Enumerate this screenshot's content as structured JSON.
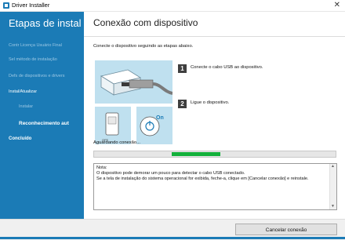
{
  "window": {
    "title": "Driver Installer",
    "close_icon": "close-icon"
  },
  "sidebar": {
    "title": "Etapas de instal",
    "steps": [
      {
        "label": "Contr Licença Usuário Final",
        "state": "done"
      },
      {
        "label": "Sel método de instalação",
        "state": "done"
      },
      {
        "label": "Defs de dispositivos e drivers",
        "state": "done"
      },
      {
        "label": "Instal/Atualizar",
        "state": "current"
      },
      {
        "label": "Instalar",
        "state": "sub-done"
      },
      {
        "label": "Reconhecimento aut",
        "state": "sub-current"
      },
      {
        "label": "Concluído",
        "state": "pending"
      }
    ]
  },
  "main": {
    "title": "Conexão com dispositivo",
    "instruction": "Conecte o dispositivo seguindo as etapas abaixo.",
    "steps": [
      {
        "number": "1",
        "text": "Conecte o cabo USB ao dispositivo."
      },
      {
        "number": "2",
        "text": "Ligue o dispositivo."
      }
    ],
    "illustration": {
      "power_label": "On",
      "switch_off_label": "OFF"
    },
    "status": "Aguardando conexão...",
    "progress": {
      "fraction_start": 0.32,
      "fraction_end": 0.52,
      "color": "#13b13b"
    },
    "note": "Nota:\nO dispositivo pode demorar um pouco para detectar o cabo USB conectado.\nSe a tela de instalação do sistema operacional for exibida, feche-a, clique em [Cancelar conexão] e reinstale."
  },
  "footer": {
    "cancel_label": "Cancelar conexão"
  },
  "colors": {
    "accent": "#1b7bb6",
    "progress": "#13b13b"
  }
}
